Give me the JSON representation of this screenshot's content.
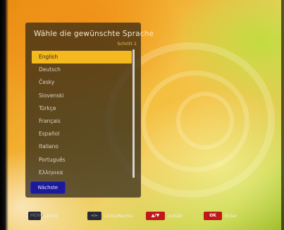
{
  "dialog": {
    "title": "Wähle die gewünschte Sprache",
    "step": "Schritt 1",
    "languages": [
      "English",
      "Deutsch",
      "Česky",
      "Slovenski",
      "Türkçe",
      "Français",
      "Español",
      "Italiano",
      "Português",
      "Ελληνικα"
    ],
    "selected_index": 0,
    "next_label": "Nächste"
  },
  "hints": {
    "menu_key": "MENU",
    "menu_label": "Letzte",
    "leftright_key": "◄/►",
    "leftright_label": "Links/Rechts",
    "updown_key": "▲/▼",
    "updown_label": "auf/ab",
    "ok_key": "OK",
    "ok_label": "Enter"
  },
  "colors": {
    "highlight": "#f3b91f",
    "next_button": "#1a1a9a",
    "ok_key": "#c01818"
  }
}
